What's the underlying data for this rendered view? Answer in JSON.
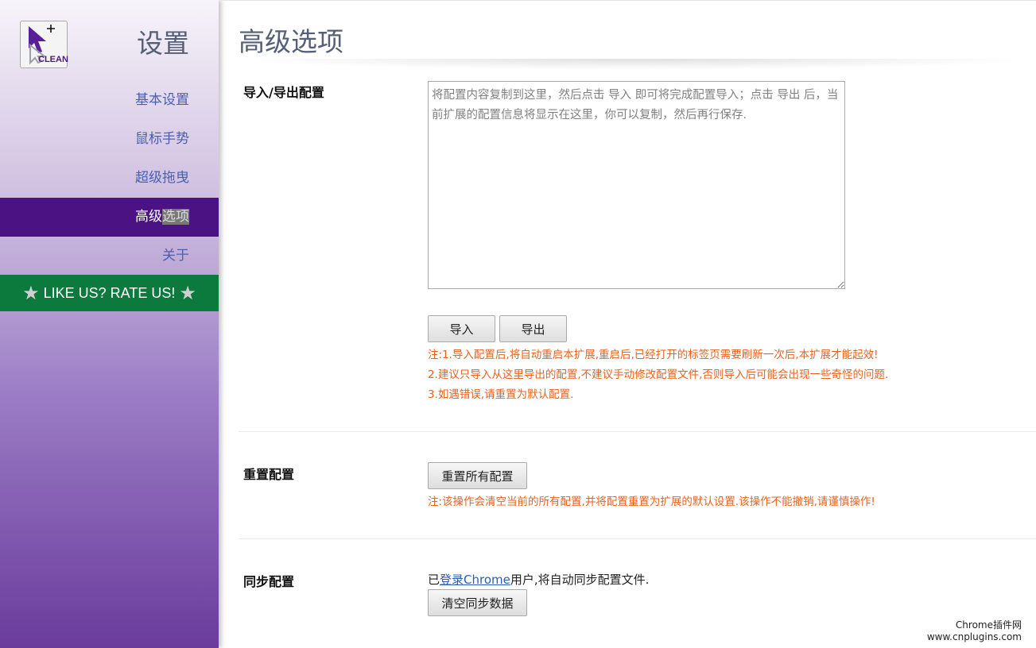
{
  "sidebar": {
    "logo_text": "CLEAN",
    "title": "设置",
    "items": [
      {
        "label": "基本设置"
      },
      {
        "label": "鼠标手势"
      },
      {
        "label": "超级拖曳"
      },
      {
        "label_a": "高级",
        "label_b": "选项"
      },
      {
        "label": "关于"
      }
    ],
    "rate": "LIKE US? RATE US!"
  },
  "main": {
    "title": "高级选项",
    "import_export": {
      "label": "导入/导出配置",
      "placeholder": "将配置内容复制到这里，然后点击 导入 即可将完成配置导入；点击 导出 后，当前扩展的配置信息将显示在这里，你可以复制，然后再行保存.",
      "import_label": "导入",
      "export_label": "导出",
      "notes": [
        "注:1.导入配置后,将自动重启本扩展,重启后,已经打开的标签页需要刷新一次后,本扩展才能起效!",
        "2.建议只导入从这里导出的配置,不建议手动修改配置文件,否则导入后可能会出现一些奇怪的问题.",
        "3.如遇错误,请重置为默认配置."
      ]
    },
    "reset": {
      "label": "重置配置",
      "button_label": "重置所有配置",
      "note": "注:该操作会清空当前的所有配置,并将配置重置为扩展的默认设置.该操作不能撤销,请谨慎操作!"
    },
    "sync": {
      "label": "同步配置",
      "text_prefix": "已",
      "link_text": "登录Chrome",
      "text_suffix": "用户,将自动同步配置文件.",
      "button_label": "清空同步数据"
    }
  },
  "watermark": {
    "line1": "Chrome插件网",
    "line2": "www.cnplugins.com"
  }
}
